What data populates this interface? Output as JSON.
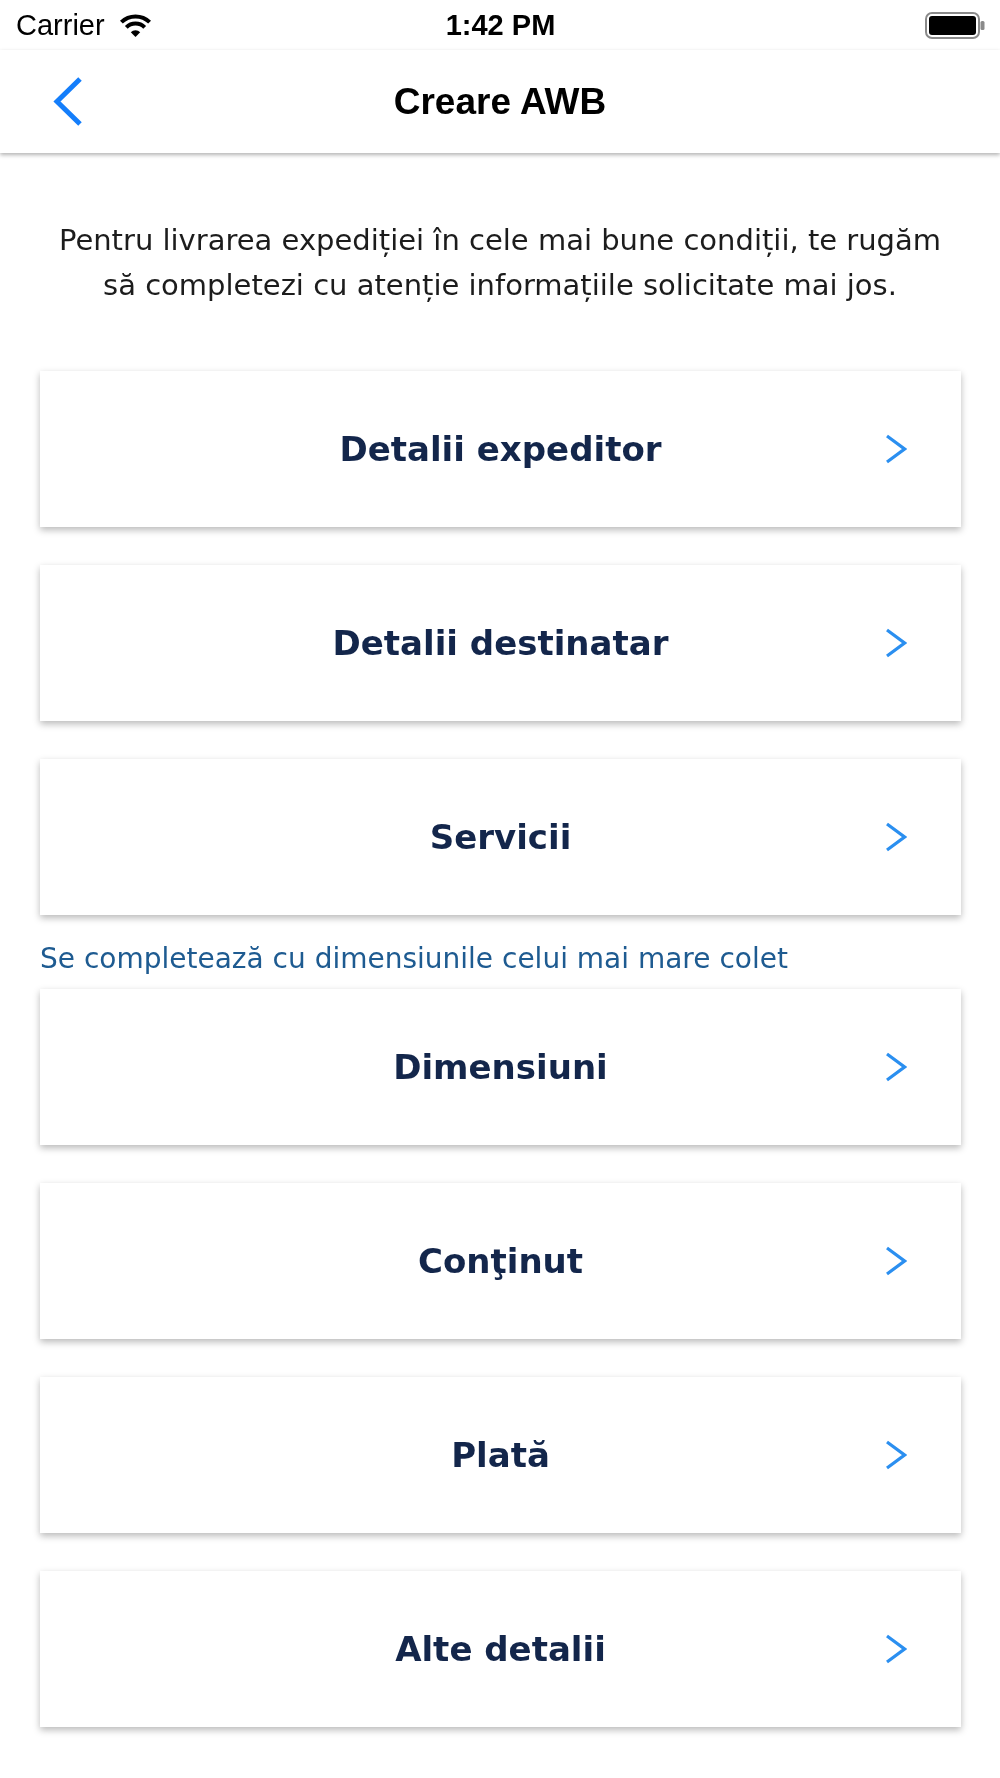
{
  "status_bar": {
    "carrier": "Carrier",
    "time": "1:42 PM"
  },
  "nav_bar": {
    "title": "Creare AWB"
  },
  "intro": "Pentru livrarea expediției în cele mai bune condiții, te rugăm să completezi cu atenție informațiile solicitate mai jos.",
  "sections": [
    {
      "kind": "card",
      "label": "Detalii expeditor"
    },
    {
      "kind": "card",
      "label": "Detalii destinatar"
    },
    {
      "kind": "card",
      "label": "Servicii"
    },
    {
      "kind": "note",
      "text": "Se completează cu dimensiunile celui mai mare colet"
    },
    {
      "kind": "card",
      "label": "Dimensiuni"
    },
    {
      "kind": "card",
      "label": "Conţinut"
    },
    {
      "kind": "card",
      "label": "Plată"
    },
    {
      "kind": "card",
      "label": "Alte detalii"
    }
  ]
}
